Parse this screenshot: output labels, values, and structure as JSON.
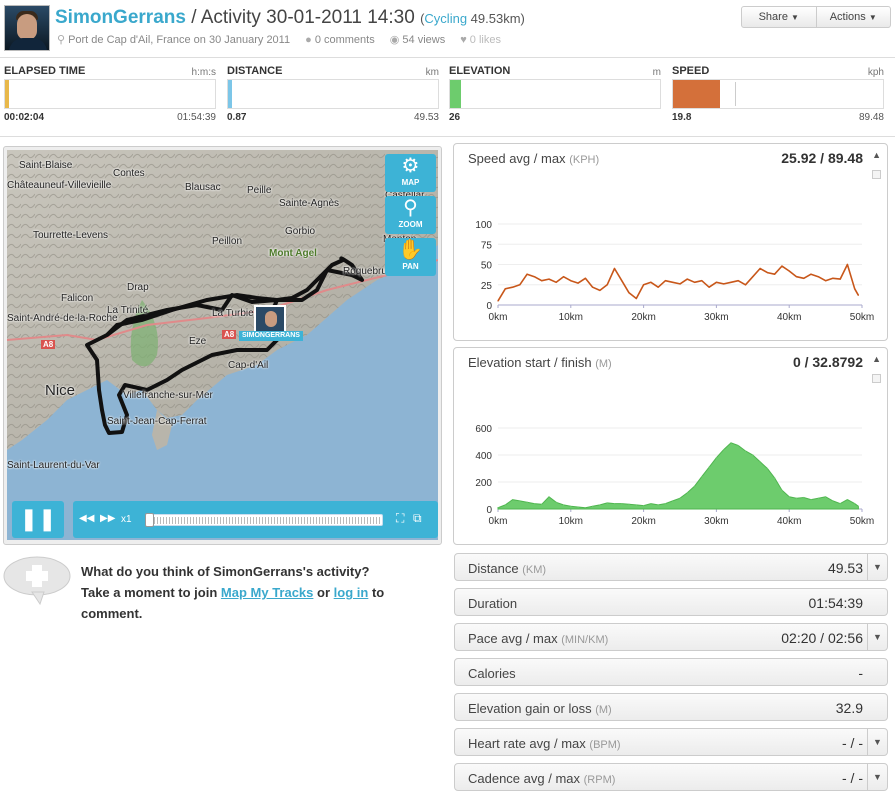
{
  "header": {
    "user": "SimonGerrans",
    "title_rest": "/ Activity 30-01-2011 14:30",
    "sport_open": "(",
    "sport": "Cycling",
    "distance": "49.53km)",
    "location": "Port de Cap d'Ail, France on 30 January 2011",
    "comments": "0 comments",
    "views": "54 views",
    "likes": "0 likes",
    "share_label": "Share",
    "actions_label": "Actions"
  },
  "metrics": [
    {
      "label": "ELAPSED TIME",
      "unit": "h:m:s",
      "current": "00:02:04",
      "total": "01:54:39",
      "color": "#e8b84a",
      "progress": 0.018
    },
    {
      "label": "DISTANCE",
      "unit": "km",
      "current": "0.87",
      "total": "49.53",
      "color": "#7cc6e8",
      "progress": 0.018
    },
    {
      "label": "ELEVATION",
      "unit": "m",
      "current": "26",
      "total": "",
      "color": "#6dcc6d",
      "progress": 0.05
    },
    {
      "label": "SPEED",
      "unit": "kph",
      "current": "19.8",
      "total": "89.48",
      "color": "#d4703a",
      "progress": 0.221
    }
  ],
  "map": {
    "tools": [
      {
        "label": "MAP",
        "icon": "gear-icon"
      },
      {
        "label": "ZOOM",
        "icon": "magnifier-icon"
      },
      {
        "label": "PAN",
        "icon": "hand-icon"
      }
    ],
    "marker_label": "SIMONGERRANS",
    "places": {
      "p0": "Saint-Blaise",
      "p1": "Contes",
      "p2": "Châteauneuf-Villevieille",
      "p3": "Blausac",
      "p4": "Peille",
      "p5": "Sainte-Agnès",
      "p6": "Castellar",
      "p7": "Tourrette-Levens",
      "p8": "Peillon",
      "p9": "Gorbio",
      "p10": "Menton",
      "p11": "Mont Agel",
      "p12": "Roquebrune",
      "p13": "Falicon",
      "p14": "Drap",
      "p15": "La Trinité",
      "p16": "Saint-André-de-la-Roche",
      "p17": "La Turbie",
      "p18": "A8",
      "p19": "A8",
      "p20": "Eze",
      "p21": "Nice",
      "p22": "Cap-d'Ail",
      "p23": "Villefranche-sur-Mer",
      "p24": "Saint-Jean-Cap-Ferrat",
      "p25": "Saint-Laurent-du-Var"
    },
    "speed_label": "x1"
  },
  "comment": {
    "line1": "What do you think of SimonGerrans's activity?",
    "pre": "Take a moment to join",
    "join_link": "Map My Tracks",
    "or": "or",
    "login_link": "log in",
    "post": "to comment."
  },
  "chart_data": [
    {
      "type": "line",
      "title": "Speed avg / max",
      "unit": "(KPH)",
      "summary": "25.92 / 89.48",
      "xlabel": "",
      "ylabel": "",
      "xlim": [
        0,
        50
      ],
      "ylim": [
        0,
        100
      ],
      "x_ticks": [
        "0km",
        "10km",
        "20km",
        "30km",
        "40km",
        "50km"
      ],
      "y_ticks": [
        "0",
        "25",
        "50",
        "75",
        "100"
      ],
      "color": "#c8571a",
      "x": [
        0,
        1,
        2,
        3,
        4,
        5,
        6,
        7,
        8,
        9,
        10,
        11,
        12,
        13,
        14,
        15,
        16,
        17,
        18,
        19,
        20,
        21,
        22,
        23,
        24,
        25,
        26,
        27,
        28,
        29,
        30,
        31,
        32,
        33,
        34,
        35,
        36,
        37,
        38,
        39,
        40,
        41,
        42,
        43,
        44,
        45,
        46,
        47,
        48,
        49,
        49.5
      ],
      "values": [
        5,
        20,
        22,
        25,
        38,
        35,
        30,
        32,
        28,
        35,
        30,
        27,
        33,
        22,
        18,
        25,
        45,
        30,
        15,
        8,
        25,
        28,
        22,
        30,
        28,
        26,
        32,
        28,
        30,
        22,
        28,
        26,
        28,
        30,
        25,
        35,
        45,
        40,
        38,
        48,
        42,
        35,
        33,
        38,
        35,
        30,
        33,
        32,
        50,
        20,
        12
      ]
    },
    {
      "type": "area",
      "title": "Elevation start / finish",
      "unit": "(M)",
      "summary": "0 / 32.8792",
      "xlabel": "",
      "ylabel": "",
      "xlim": [
        0,
        50
      ],
      "ylim": [
        0,
        600
      ],
      "x_ticks": [
        "0km",
        "10km",
        "20km",
        "30km",
        "40km",
        "50km"
      ],
      "y_ticks": [
        "0",
        "200",
        "400",
        "600"
      ],
      "color": "#6dcc6d",
      "x": [
        0,
        1,
        2,
        3,
        4,
        5,
        6,
        7,
        8,
        9,
        10,
        11,
        12,
        13,
        14,
        15,
        16,
        17,
        18,
        19,
        20,
        21,
        22,
        23,
        24,
        25,
        26,
        27,
        28,
        29,
        30,
        31,
        32,
        33,
        34,
        35,
        36,
        37,
        38,
        39,
        40,
        41,
        42,
        43,
        44,
        45,
        46,
        47,
        48,
        49,
        49.5
      ],
      "values": [
        10,
        30,
        70,
        60,
        50,
        40,
        35,
        90,
        50,
        30,
        20,
        15,
        10,
        20,
        30,
        45,
        40,
        40,
        35,
        30,
        25,
        40,
        30,
        40,
        60,
        80,
        120,
        170,
        240,
        310,
        380,
        440,
        490,
        470,
        430,
        400,
        350,
        300,
        230,
        140,
        90,
        80,
        85,
        70,
        80,
        90,
        60,
        40,
        70,
        40,
        20
      ]
    }
  ],
  "stats": [
    {
      "label": "Distance",
      "unit": "(KM)",
      "value": "49.53",
      "expand": true
    },
    {
      "label": "Duration",
      "unit": "",
      "value": "01:54:39",
      "expand": false
    },
    {
      "label": "Pace avg / max",
      "unit": "(MIN/KM)",
      "value": "02:20 / 02:56",
      "expand": true
    },
    {
      "label": "Calories",
      "unit": "",
      "value": "-",
      "expand": false
    },
    {
      "label": "Elevation gain or loss",
      "unit": "(M)",
      "value": "32.9",
      "expand": false
    },
    {
      "label": "Heart rate avg / max",
      "unit": "(BPM)",
      "value": "- / -",
      "expand": true
    },
    {
      "label": "Cadence avg / max",
      "unit": "(RPM)",
      "value": "- / -",
      "expand": true
    }
  ]
}
